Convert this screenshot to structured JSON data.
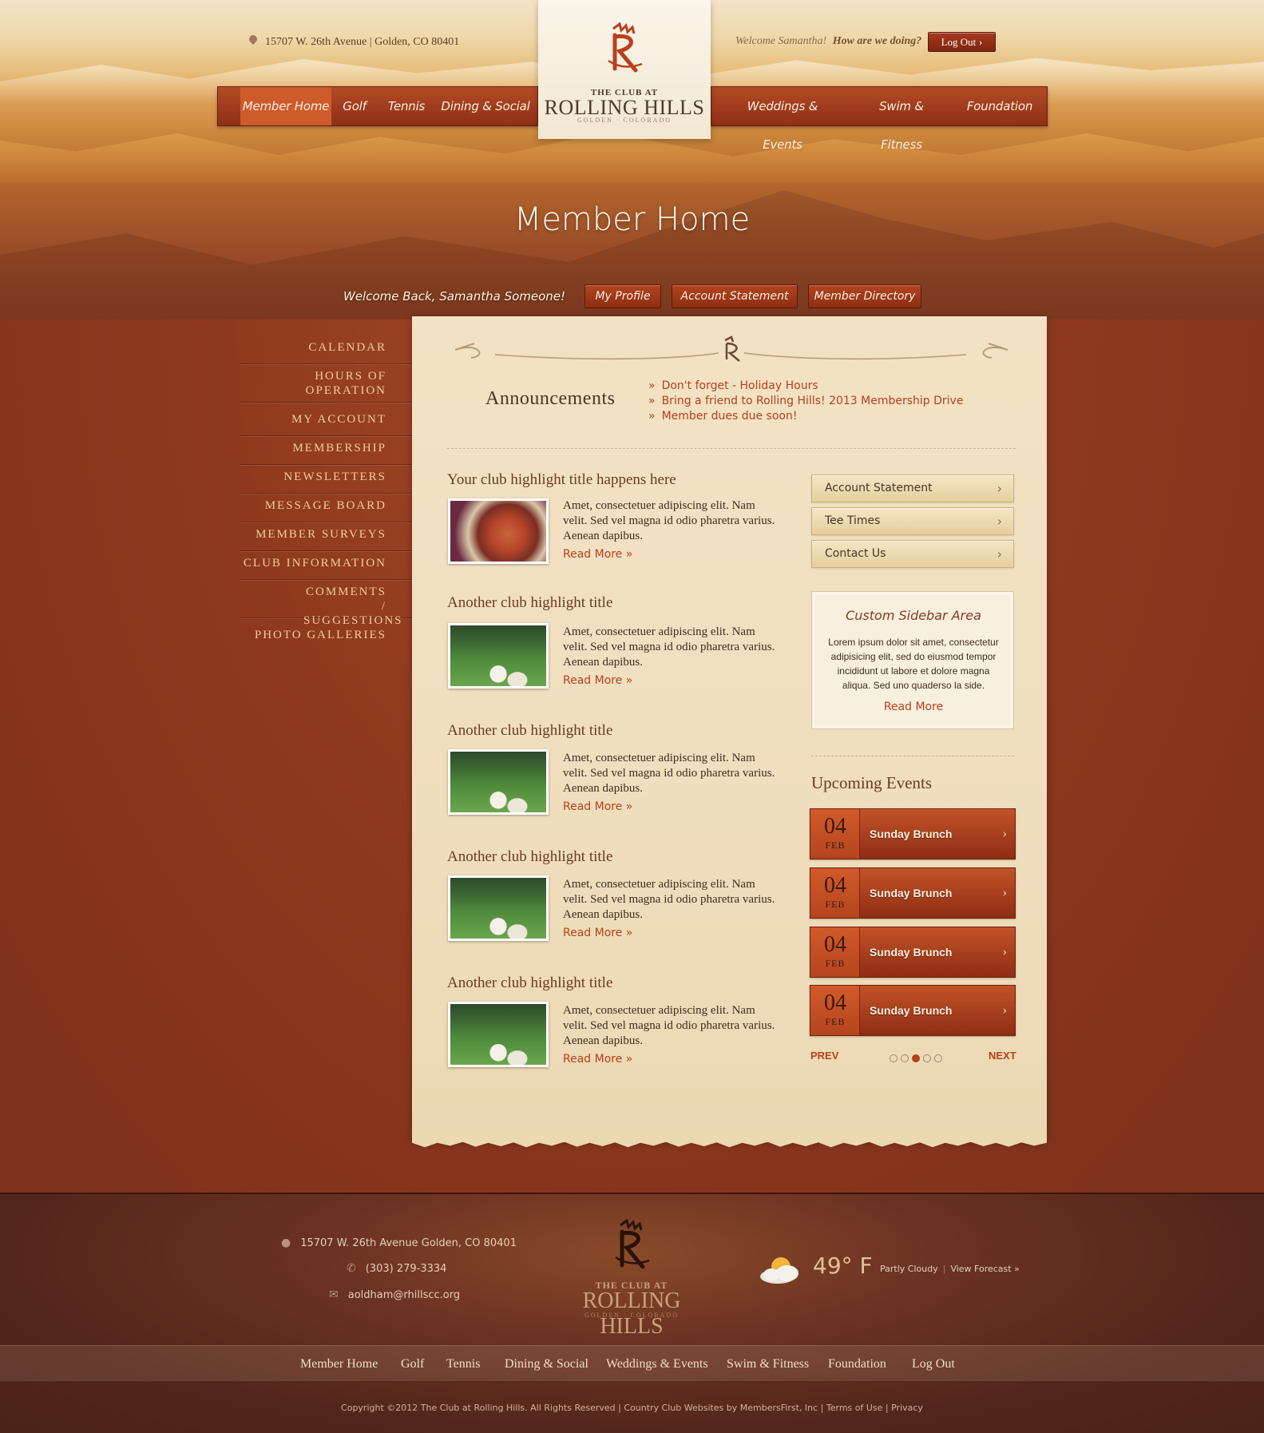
{
  "header": {
    "address": "15707 W. 26th Avenue  |  Golden, CO 80401",
    "welcome": "Welcome Samantha!",
    "feedback_link": "How are we doing?",
    "logout": "Log Out"
  },
  "logo": {
    "pre": "THE CLUB AT",
    "name": "ROLLING HILLS",
    "sub": "GOLDEN · COLORADO"
  },
  "nav_left": [
    "Member Home",
    "Golf",
    "Tennis",
    "Dining & Social"
  ],
  "nav_right": [
    "Weddings & Events",
    "Swim & Fitness",
    "Foundation"
  ],
  "hero": {
    "title": "Member Home",
    "welcome_back": "Welcome Back, Samantha Someone!",
    "buttons": [
      "My Profile",
      "Account Statement",
      "Member Directory"
    ]
  },
  "sidebar": [
    "CALENDAR",
    "HOURS OF OPERATION",
    "MY ACCOUNT",
    "MEMBERSHIP",
    "NEWSLETTERS",
    "MESSAGE BOARD",
    "MEMBER SURVEYS",
    "CLUB INFORMATION",
    "COMMENTS / SUGGESTIONS",
    "PHOTO GALLERIES"
  ],
  "announcements": {
    "title": "Announcements",
    "items": [
      "Don't forget - Holiday Hours",
      "Bring a friend to Rolling Hills! 2013 Membership Drive",
      "Member dues due soon!"
    ]
  },
  "highlights": [
    {
      "title": "Your club highlight title happens here",
      "text": "Amet, consectetuer adipiscing elit. Nam velit. Sed vel magna id odio pharetra varius. Aenean dapibus.",
      "more": "Read More »",
      "image": "food"
    },
    {
      "title": "Another club highlight title",
      "text": "Amet, consectetuer adipiscing elit. Nam velit. Sed vel magna id odio pharetra varius. Aenean dapibus.",
      "more": "Read More »",
      "image": "golf"
    },
    {
      "title": "Another club highlight title",
      "text": "Amet, consectetuer adipiscing elit. Nam velit. Sed vel magna id odio pharetra varius. Aenean dapibus.",
      "more": "Read More »",
      "image": "golf"
    },
    {
      "title": "Another club highlight title",
      "text": "Amet, consectetuer adipiscing elit. Nam velit. Sed vel magna id odio pharetra varius. Aenean dapibus.",
      "more": "Read More »",
      "image": "golf"
    },
    {
      "title": "Another club highlight title",
      "text": "Amet, consectetuer adipiscing elit. Nam velit. Sed vel magna id odio pharetra varius. Aenean dapibus.",
      "more": "Read More »",
      "image": "golf"
    }
  ],
  "quick_links": [
    "Account Statement",
    "Tee Times",
    "Contact Us"
  ],
  "custom_sidebar": {
    "title": "Custom Sidebar Area",
    "text": "Lorem ipsum dolor sit amet, consectetur adipisicing elit, sed do eiusmod tempor incididunt ut labore et dolore magna aliqua. Sed uno quaderso la side.",
    "more": "Read More"
  },
  "upcoming_events": {
    "title": "Upcoming Events",
    "events": [
      {
        "day": "04",
        "month": "FEB",
        "name": "Sunday Brunch"
      },
      {
        "day": "04",
        "month": "FEB",
        "name": "Sunday Brunch"
      },
      {
        "day": "04",
        "month": "FEB",
        "name": "Sunday Brunch"
      },
      {
        "day": "04",
        "month": "FEB",
        "name": "Sunday Brunch"
      }
    ],
    "prev": "PREV",
    "next": "NEXT",
    "pages": 5,
    "current_page": 3
  },
  "footer": {
    "address": "15707 W. 26th Avenue  Golden, CO 80401",
    "phone": "(303) 279-3334",
    "email": "aoldham@rhillscc.org",
    "temperature": "49° F",
    "condition": "Partly Cloudy",
    "forecast_link": "View Forecast »",
    "nav": [
      "Member Home",
      "Golf",
      "Tennis",
      "Dining & Social",
      "Weddings & Events",
      "Swim & Fitness",
      "Foundation",
      "Log Out"
    ],
    "copyright": "Copyright ©2012 The Club at Rolling Hills. All Rights Reserved | Country Club Websites by MembersFirst, Inc | Terms of Use | Privacy"
  },
  "colors": {
    "accent": "#b8401d",
    "nav_bg": "#a3411f",
    "paper": "#f0dfbf",
    "footer_bg": "#53261b"
  }
}
